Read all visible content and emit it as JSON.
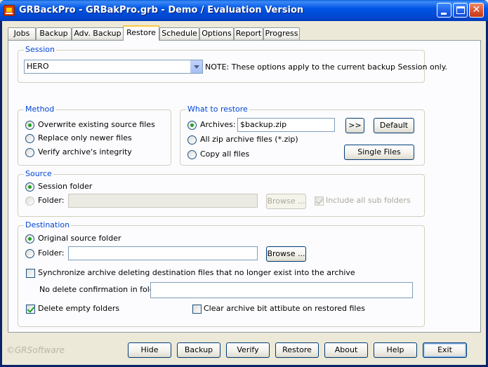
{
  "window": {
    "title": "GRBackPro - GRBakPro.grb - Demo / Evaluation Version"
  },
  "tabs": [
    {
      "label": "Jobs"
    },
    {
      "label": "Backup"
    },
    {
      "label": "Adv. Backup"
    },
    {
      "label": "Restore",
      "active": true
    },
    {
      "label": "Schedule"
    },
    {
      "label": "Options"
    },
    {
      "label": "Report"
    },
    {
      "label": "Progress"
    }
  ],
  "session": {
    "title": "Session",
    "selected": "HERO",
    "note": "NOTE: These options apply to the current backup Session only."
  },
  "method": {
    "title": "Method",
    "options": [
      {
        "label": "Overwrite existing source files",
        "checked": true
      },
      {
        "label": "Replace only newer files",
        "checked": false
      },
      {
        "label": "Verify archive's integrity",
        "checked": false
      }
    ]
  },
  "what_to_restore": {
    "title": "What to restore",
    "archives_label": "Archives:",
    "archives_value": "$backup.zip",
    "more_button": ">>",
    "default_button": "Default",
    "all_zip_label": "All zip archive files (*.zip)",
    "copy_all_label": "Copy all files",
    "single_files_button": "Single Files",
    "selected": "archives"
  },
  "source": {
    "title": "Source",
    "session_folder_label": "Session folder",
    "folder_label": "Folder:",
    "folder_value": "",
    "browse_button": "Browse ...",
    "include_sub_label": "Include all sub folders",
    "include_sub_checked": true,
    "selected": "session_folder"
  },
  "destination": {
    "title": "Destination",
    "original_label": "Original source folder",
    "folder_label": "Folder:",
    "folder_value": "",
    "browse_button": "Browse ...",
    "sync_label": "Synchronize archive deleting destination files that no longer exist into the archive",
    "sync_checked": false,
    "no_delete_label": "No delete confirmation in folders:",
    "no_delete_value": "",
    "delete_empty_label": "Delete empty folders",
    "delete_empty_checked": true,
    "clear_bit_label": "Clear archive bit attibute on restored files",
    "clear_bit_checked": false,
    "selected": "original"
  },
  "footer": {
    "copyright": "©GRSoftware",
    "buttons": {
      "hide": "Hide",
      "backup": "Backup",
      "verify": "Verify",
      "restore": "Restore",
      "about": "About",
      "help": "Help",
      "exit": "Exit"
    }
  }
}
